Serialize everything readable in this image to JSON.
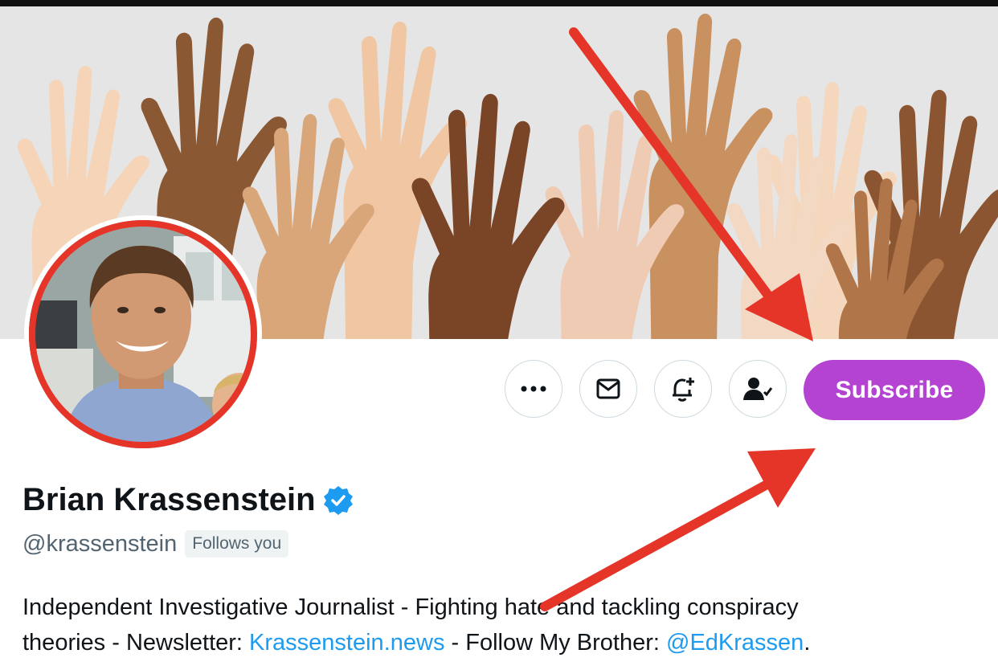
{
  "profile": {
    "name": "Brian Krassenstein",
    "handle": "@krassenstein",
    "follows_you": "Follows you",
    "verified": true,
    "bio": {
      "line1": "Independent Investigative Journalist - Fighting hate and tackling conspiracy",
      "line2_before_link": "theories - Newsletter: ",
      "newsletter_link": "Krassenstein.news",
      "line2_middle": " - Follow My Brother: ",
      "brother_link": "@EdKrassen",
      "line2_end": "."
    }
  },
  "actions": {
    "more_icon": "more-horizontal-icon",
    "message_icon": "envelope-icon",
    "notify_icon": "bell-plus-icon",
    "following_icon": "person-check-icon",
    "subscribe_label": "Subscribe"
  },
  "colors": {
    "subscribe_bg": "#b443d2",
    "annotation_arrow": "#e53529",
    "avatar_ring": "#e53529",
    "link": "#1d9bf0",
    "verified_badge": "#1d9bf0"
  },
  "banner": {
    "description_icon": "raised-hands-illustration"
  }
}
